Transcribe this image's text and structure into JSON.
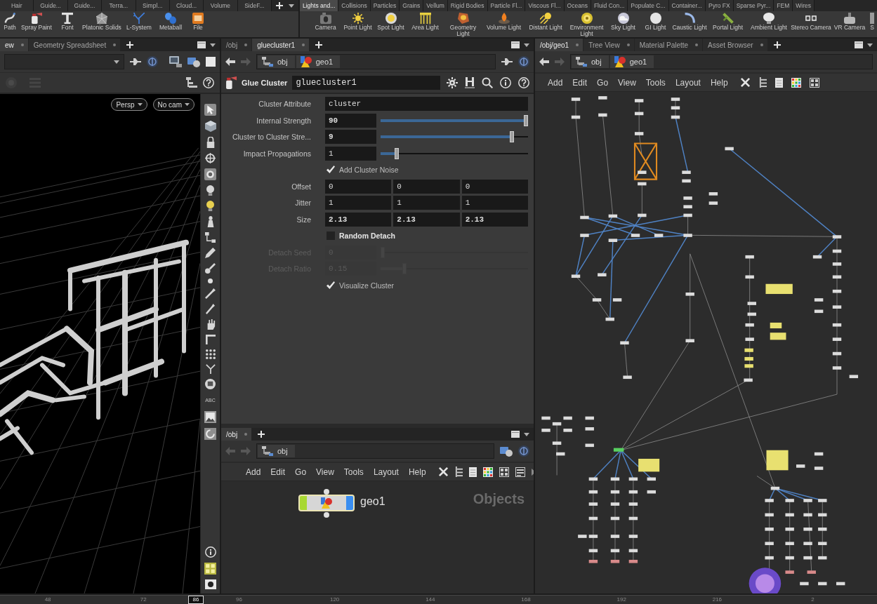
{
  "shelf_left": {
    "tabs": [
      {
        "label": "Hair",
        "selected": false
      },
      {
        "label": "Guide...",
        "selected": false
      },
      {
        "label": "Guide...",
        "selected": false
      },
      {
        "label": "Terra...",
        "selected": false
      },
      {
        "label": "Simpl...",
        "selected": false
      },
      {
        "label": "Cloud...",
        "selected": false
      },
      {
        "label": "Volume",
        "selected": false
      },
      {
        "label": "SideF...",
        "selected": false
      }
    ],
    "tools": [
      "Path",
      "Spray Paint",
      "Font",
      "Platonic Solids",
      "L-System",
      "Metaball",
      "File"
    ]
  },
  "shelf_right": {
    "tabs": [
      {
        "label": "Lights and...",
        "selected": true
      },
      {
        "label": "Collisions",
        "selected": false
      },
      {
        "label": "Particles",
        "selected": false
      },
      {
        "label": "Grains",
        "selected": false
      },
      {
        "label": "Vellum",
        "selected": false
      },
      {
        "label": "Rigid Bodies",
        "selected": false
      },
      {
        "label": "Particle Fl...",
        "selected": false
      },
      {
        "label": "Viscous Fl...",
        "selected": false
      },
      {
        "label": "Oceans",
        "selected": false
      },
      {
        "label": "Fluid Con...",
        "selected": false
      },
      {
        "label": "Populate C...",
        "selected": false
      },
      {
        "label": "Container...",
        "selected": false
      },
      {
        "label": "Pyro FX",
        "selected": false
      },
      {
        "label": "Sparse Pyr...",
        "selected": false
      },
      {
        "label": "FEM",
        "selected": false
      },
      {
        "label": "Wires",
        "selected": false
      }
    ],
    "tools": [
      "Camera",
      "Point Light",
      "Spot Light",
      "Area Light",
      "Geometry Light",
      "Volume Light",
      "Distant Light",
      "Environment Light",
      "Sky Light",
      "GI Light",
      "Caustic Light",
      "Portal Light",
      "Ambient Light",
      "Stereo Camera",
      "VR Camera",
      "S"
    ]
  },
  "scene_viewer": {
    "tabs": [
      {
        "label": "ew",
        "selected": true
      },
      {
        "label": "Geometry Spreadsheet",
        "selected": false
      }
    ],
    "camera_menus": [
      "Persp",
      "No cam"
    ],
    "side_tool_text": "ABC"
  },
  "parameter_editor": {
    "tabs": [
      {
        "label": "/obj",
        "selected": false
      },
      {
        "label": "gluecluster1",
        "selected": true
      }
    ],
    "path": [
      "obj",
      "geo1"
    ],
    "node_type": "Glue Cluster",
    "node_name": "gluecluster1",
    "parameters": [
      {
        "kind": "string",
        "label": "Cluster Attribute",
        "value": "cluster",
        "modified": false,
        "disabled": false
      },
      {
        "kind": "slider",
        "label": "Internal Strength",
        "value": "90",
        "level": 1,
        "modified": true,
        "disabled": false
      },
      {
        "kind": "slider",
        "label": "Cluster to Cluster Stre...",
        "value": "9",
        "level": 0.9,
        "modified": true,
        "disabled": false
      },
      {
        "kind": "slider",
        "label": "Impact Propagations",
        "value": "1",
        "level": 0.1,
        "modified": false,
        "disabled": false
      },
      {
        "kind": "toggle",
        "label": "Add Cluster Noise",
        "checked": true,
        "modified": false,
        "disabled": false
      },
      {
        "kind": "vector",
        "label": "Offset",
        "values": [
          "0",
          "0",
          "0"
        ],
        "modified": false,
        "disabled": false
      },
      {
        "kind": "vector",
        "label": "Jitter",
        "values": [
          "1",
          "1",
          "1"
        ],
        "modified": false,
        "disabled": false
      },
      {
        "kind": "vector",
        "label": "Size",
        "values": [
          "2.13",
          "2.13",
          "2.13"
        ],
        "modified": true,
        "disabled": false
      },
      {
        "kind": "toggle",
        "label": "Random Detach",
        "checked": false,
        "modified": true,
        "disabled": false
      },
      {
        "kind": "slider",
        "label": "Detach Seed",
        "value": "0",
        "level": 0,
        "modified": false,
        "disabled": true
      },
      {
        "kind": "slider",
        "label": "Detach Ratio",
        "value": "0.15",
        "level": 0.15,
        "modified": false,
        "disabled": true
      },
      {
        "kind": "toggle",
        "label": "Visualize Cluster",
        "checked": true,
        "modified": false,
        "disabled": false
      }
    ]
  },
  "object_network": {
    "tabs": [
      {
        "label": "/obj",
        "selected": true
      }
    ],
    "path": [
      "obj"
    ],
    "menu": [
      "Add",
      "Edit",
      "Go",
      "View",
      "Tools",
      "Layout",
      "Help"
    ],
    "node": {
      "name": "geo1"
    },
    "context_label": "Objects"
  },
  "geo_network": {
    "tabs": [
      {
        "label": "/obj/geo1",
        "selected": true
      },
      {
        "label": "Tree View",
        "selected": false
      },
      {
        "label": "Material Palette",
        "selected": false
      },
      {
        "label": "Asset Browser",
        "selected": false
      }
    ],
    "path": [
      "obj",
      "geo1"
    ],
    "menu": [
      "Add",
      "Edit",
      "Go",
      "View",
      "Tools",
      "Layout",
      "Help"
    ]
  },
  "timeline": {
    "ticks": [
      "48",
      "72",
      "96",
      "120",
      "144",
      "168",
      "192",
      "216",
      "2"
    ],
    "current_frame": "86"
  }
}
